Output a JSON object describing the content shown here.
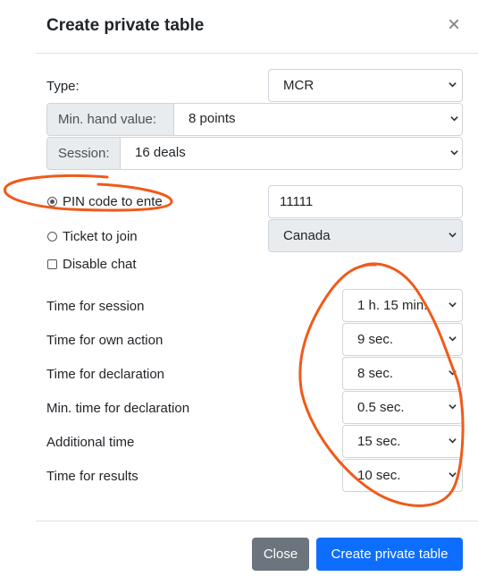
{
  "dialog": {
    "title": "Create private table",
    "close_glyph": "×"
  },
  "type_field": {
    "label": "Type:",
    "value": "MCR"
  },
  "min_hand": {
    "addon": "Min. hand value:",
    "value": "8 points"
  },
  "session": {
    "addon": "Session:",
    "value": "16 deals"
  },
  "pin": {
    "label": "PIN code to ente",
    "value": "11111",
    "selected": true
  },
  "ticket": {
    "label": "Ticket to join",
    "value": "Canada",
    "selected": false
  },
  "disable_chat": {
    "label": "Disable chat",
    "checked": false
  },
  "timings": [
    {
      "label": "Time for session",
      "value": "1 h. 15 min."
    },
    {
      "label": "Time for own action",
      "value": "9 sec."
    },
    {
      "label": "Time for declaration",
      "value": "8 sec."
    },
    {
      "label": "Min. time for declaration",
      "value": "0.5 sec."
    },
    {
      "label": "Additional time",
      "value": "15 sec."
    },
    {
      "label": "Time for results",
      "value": "10 sec."
    }
  ],
  "buttons": {
    "close": "Close",
    "create": "Create private table"
  },
  "colors": {
    "primary": "#0d6efd",
    "secondary": "#6c757d",
    "annotation": "#f05a1a"
  }
}
